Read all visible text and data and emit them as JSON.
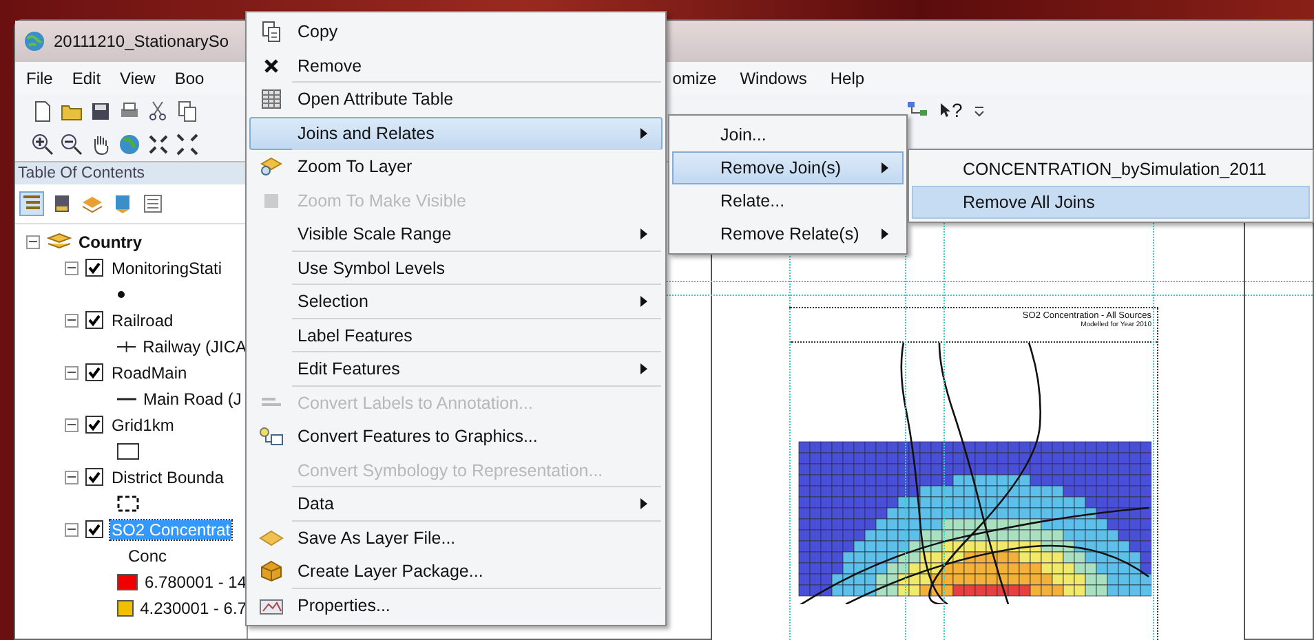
{
  "window": {
    "title": "20111210_StationarySo"
  },
  "menu_bar": {
    "left": [
      "File",
      "Edit",
      "View",
      "Boo"
    ],
    "right": [
      "omize",
      "Windows",
      "Help"
    ]
  },
  "toolbar": {
    "help_glyph": "?"
  },
  "toc": {
    "title": "Table Of Contents",
    "tree": [
      {
        "label": "Country",
        "expanded": true,
        "children": [
          {
            "label": "MonitoringStati",
            "checked": true,
            "expanded": true,
            "selected": false,
            "legend": [
              {
                "kind": "point"
              }
            ]
          },
          {
            "label": "Railroad",
            "checked": true,
            "expanded": true,
            "selected": false,
            "legend": [
              {
                "kind": "railway",
                "label": "Railway (JICA"
              }
            ]
          },
          {
            "label": "RoadMain",
            "checked": true,
            "expanded": true,
            "selected": false,
            "legend": [
              {
                "kind": "road",
                "label": "Main Road (J"
              }
            ]
          },
          {
            "label": "Grid1km",
            "checked": true,
            "expanded": true,
            "selected": false,
            "legend": [
              {
                "kind": "fill"
              }
            ]
          },
          {
            "label": "District Bounda",
            "checked": true,
            "expanded": true,
            "selected": false,
            "legend": [
              {
                "kind": "dashed"
              }
            ]
          },
          {
            "label": "SO2 Concentrat",
            "checked": true,
            "expanded": true,
            "selected": true,
            "legend": [
              {
                "kind": "heading",
                "label": "Conc"
              },
              {
                "kind": "class",
                "color": "#ee0000",
                "label": "6.780001 - 14"
              },
              {
                "kind": "class",
                "color": "#f0c000",
                "label": "4.230001 - 6.7"
              }
            ]
          }
        ]
      }
    ]
  },
  "map": {
    "title": "SO2 Concentration - All Sources",
    "subtitle": "Modelled for Year 2010"
  },
  "context_menu": [
    {
      "label": "Copy",
      "disabled": false,
      "submenu": false,
      "selected": false,
      "separator_after": false
    },
    {
      "label": "Remove",
      "disabled": false,
      "submenu": false,
      "selected": false,
      "separator_after": true
    },
    {
      "label": "Open Attribute Table",
      "disabled": false,
      "submenu": false,
      "selected": false,
      "separator_after": false
    },
    {
      "label": "Joins and Relates",
      "disabled": false,
      "submenu": true,
      "selected": true,
      "separator_after": true
    },
    {
      "label": "Zoom To Layer",
      "disabled": false,
      "submenu": false,
      "selected": false,
      "separator_after": false
    },
    {
      "label": "Zoom To Make Visible",
      "disabled": true,
      "submenu": false,
      "selected": false,
      "separator_after": false
    },
    {
      "label": "Visible Scale Range",
      "disabled": false,
      "submenu": true,
      "selected": false,
      "separator_after": true
    },
    {
      "label": "Use Symbol Levels",
      "disabled": false,
      "submenu": false,
      "selected": false,
      "separator_after": true
    },
    {
      "label": "Selection",
      "disabled": false,
      "submenu": true,
      "selected": false,
      "separator_after": true
    },
    {
      "label": "Label Features",
      "disabled": false,
      "submenu": false,
      "selected": false,
      "separator_after": true
    },
    {
      "label": "Edit Features",
      "disabled": false,
      "submenu": true,
      "selected": false,
      "separator_after": true
    },
    {
      "label": "Convert Labels to Annotation...",
      "disabled": true,
      "submenu": false,
      "selected": false,
      "separator_after": false
    },
    {
      "label": "Convert Features to Graphics...",
      "disabled": false,
      "submenu": false,
      "selected": false,
      "separator_after": false
    },
    {
      "label": "Convert Symbology to Representation...",
      "disabled": true,
      "submenu": false,
      "selected": false,
      "separator_after": true
    },
    {
      "label": "Data",
      "disabled": false,
      "submenu": true,
      "selected": false,
      "separator_after": true
    },
    {
      "label": "Save As Layer File...",
      "disabled": false,
      "submenu": false,
      "selected": false,
      "separator_after": false
    },
    {
      "label": "Create Layer Package...",
      "disabled": false,
      "submenu": false,
      "selected": false,
      "separator_after": true
    },
    {
      "label": "Properties...",
      "disabled": false,
      "submenu": false,
      "selected": false,
      "separator_after": false
    }
  ],
  "joins_submenu": [
    {
      "label": "Join...",
      "submenu": false,
      "selected": false
    },
    {
      "label": "Remove Join(s)",
      "submenu": true,
      "selected": true
    },
    {
      "label": "Relate...",
      "submenu": false,
      "selected": false
    },
    {
      "label": "Remove Relate(s)",
      "submenu": true,
      "selected": false
    }
  ],
  "remove_joins_submenu": [
    {
      "label": "CONCENTRATION_bySimulation_2011",
      "selected": false
    },
    {
      "label": "Remove All Joins",
      "selected": true
    }
  ]
}
